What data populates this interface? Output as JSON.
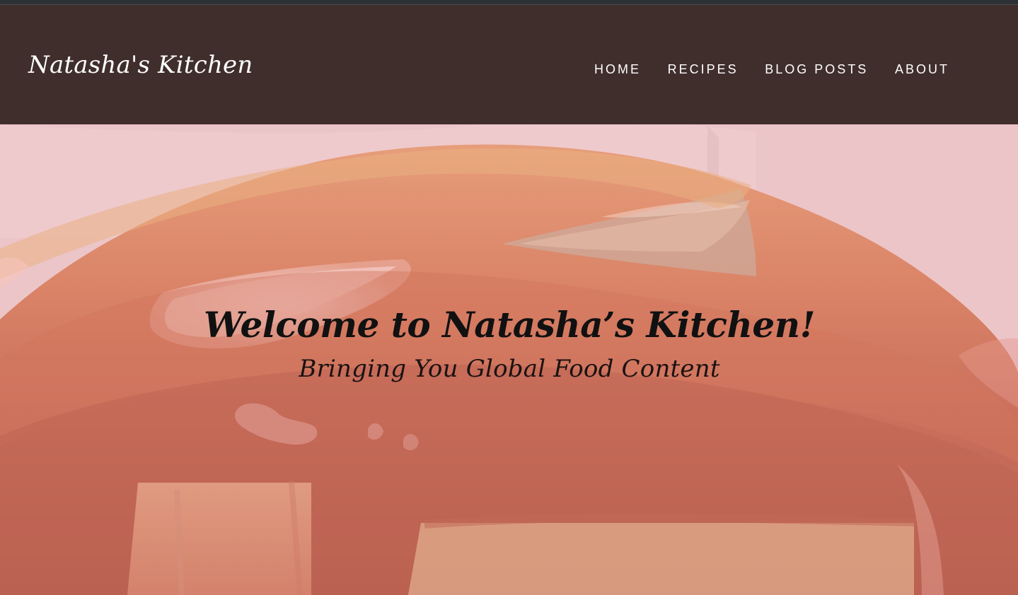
{
  "site": {
    "brand": "Natasha's Kitchen"
  },
  "navigation": {
    "items": [
      {
        "label": "HOME"
      },
      {
        "label": "RECIPES"
      },
      {
        "label": "BLOG POSTS"
      },
      {
        "label": "ABOUT"
      }
    ]
  },
  "hero": {
    "title": "Welcome to Natasha’s Kitchen!",
    "subtitle": "Bringing You Global Food Content"
  },
  "colors": {
    "navigation_background": "#2e1d1c",
    "brand_text": "#ffffff",
    "navigation_text": "#ffffff",
    "hero_text": "#111111",
    "hero_image_tint": "#e7bfc3",
    "caramel": "#c86c4f"
  }
}
